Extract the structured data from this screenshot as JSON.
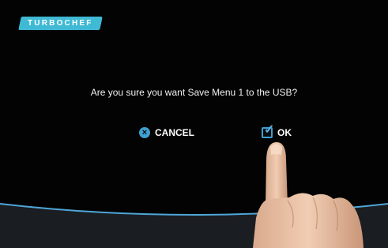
{
  "brand": {
    "logo_text": "TURBOCHEF"
  },
  "dialog": {
    "message": "Are you sure you want Save Menu 1 to the USB?",
    "cancel_label": "CANCEL",
    "ok_label": "OK"
  },
  "icons": {
    "cancel": "close-circle-icon",
    "ok": "checkbox-checked-icon"
  },
  "colors": {
    "background": "#030303",
    "accent": "#3fb9d4",
    "bottom_line": "#4fa6d8",
    "bottom_panel": "#1a1d22"
  }
}
